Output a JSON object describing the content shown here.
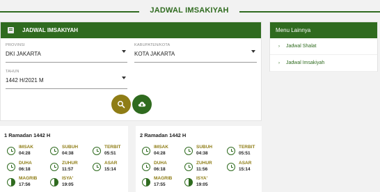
{
  "page": {
    "title": "JADWAL IMSAKIYAH"
  },
  "panel": {
    "header": "JADWAL IMSAKIYAH",
    "provinsi": {
      "label": "PROVINSI",
      "value": "DKI JAKARTA"
    },
    "kabupaten": {
      "label": "KABUPATEN/KOTA",
      "value": "KOTA JAKARTA"
    },
    "tahun": {
      "label": "TAHUN",
      "value": "1442 H/2021 M"
    },
    "search_icon": "search-icon",
    "download_icon": "cloud-download-icon"
  },
  "side_menu": {
    "title": "Menu Lainnya",
    "items": [
      {
        "label": "Jadwal Shalat"
      },
      {
        "label": "Jadwal Imsakiyah"
      }
    ]
  },
  "days": [
    {
      "title": "1 Ramadan 1442 H",
      "slots": [
        {
          "name": "IMSAK",
          "time": "04:28"
        },
        {
          "name": "SUBUH",
          "time": "04:38"
        },
        {
          "name": "TERBIT",
          "time": "05:51"
        },
        {
          "name": "DUHA",
          "time": "06:18"
        },
        {
          "name": "ZUHUR",
          "time": "11:57"
        },
        {
          "name": "ASAR",
          "time": "15:14"
        },
        {
          "name": "MAGRIB",
          "time": "17:56"
        },
        {
          "name": "ISYA'",
          "time": "19:05"
        }
      ]
    },
    {
      "title": "2 Ramadan 1442 H",
      "slots": [
        {
          "name": "IMSAK",
          "time": "04:28"
        },
        {
          "name": "SUBUH",
          "time": "04:38"
        },
        {
          "name": "TERBIT",
          "time": "05:51"
        },
        {
          "name": "DUHA",
          "time": "06:18"
        },
        {
          "name": "ZUHUR",
          "time": "11:56"
        },
        {
          "name": "ASAR",
          "time": "15:14"
        },
        {
          "name": "MAGRIB",
          "time": "17:55"
        },
        {
          "name": "ISYA'",
          "time": "19:05"
        }
      ]
    }
  ],
  "colors": {
    "primary": "#2f6b1f",
    "accent": "#8f7d16"
  }
}
